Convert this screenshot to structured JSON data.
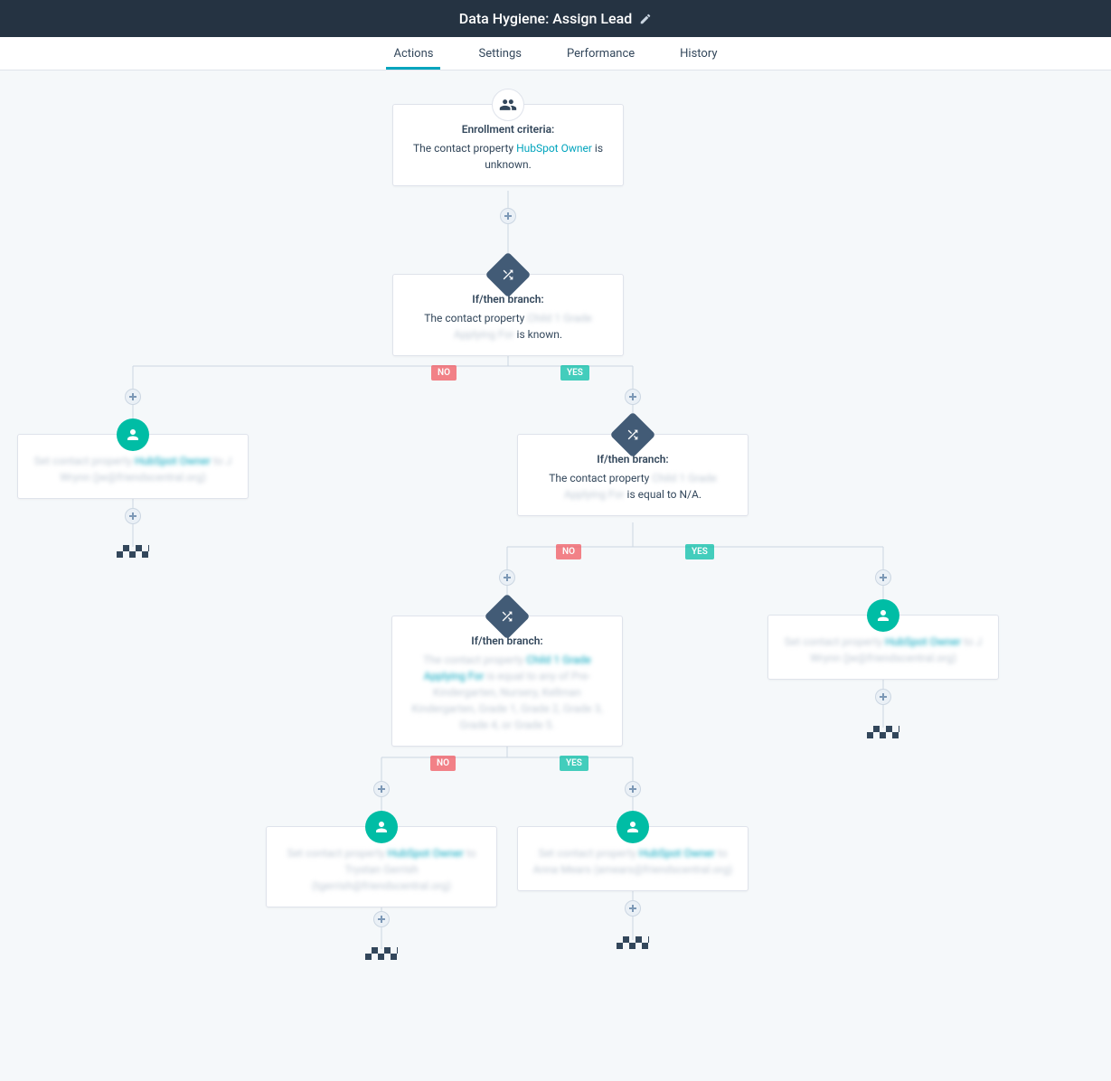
{
  "header": {
    "title": "Data Hygiene: Assign Lead"
  },
  "tabs": {
    "actions": "Actions",
    "settings": "Settings",
    "performance": "Performance",
    "history": "History"
  },
  "labels": {
    "no": "NO",
    "yes": "YES"
  },
  "nodes": {
    "enrollment": {
      "title": "Enrollment criteria:",
      "pre": "The contact property ",
      "link": "HubSpot Owner",
      "post": " is unknown."
    },
    "branch1": {
      "title": "If/then branch:",
      "pre": "The contact property ",
      "link": "Child 1 Grade Applying For",
      "post": " is known."
    },
    "action_no1": {
      "pre": "Set contact property ",
      "link": "HubSpot Owner",
      "post": " to J Wrynn (jw@friendscentral.org)"
    },
    "branch2": {
      "title": "If/then branch:",
      "pre": "The contact property ",
      "link": "Child 1 Grade Applying For",
      "post": " is equal to N/A."
    },
    "action_yes2": {
      "pre": "Set contact property ",
      "link": "HubSpot Owner",
      "post": " to J Wrynn (jw@friendscentral.org)"
    },
    "branch3": {
      "title": "If/then branch:",
      "pre": "The contact property ",
      "link": "Child 1 Grade Applying For",
      "post": " is equal to any of Pre-Kindergarten, Nursery, Kellman Kindergarten, Grade 1, Grade 2, Grade 3, Grade 4, or Grade 5."
    },
    "action_no3": {
      "pre": "Set contact property ",
      "link": "HubSpot Owner",
      "post": " to Trystan Gerrish (tgerrish@friendscentral.org)"
    },
    "action_yes3": {
      "pre": "Set contact property ",
      "link": "HubSpot Owner",
      "post": " to Anna Mears (amears@friendscentral.org)"
    }
  }
}
